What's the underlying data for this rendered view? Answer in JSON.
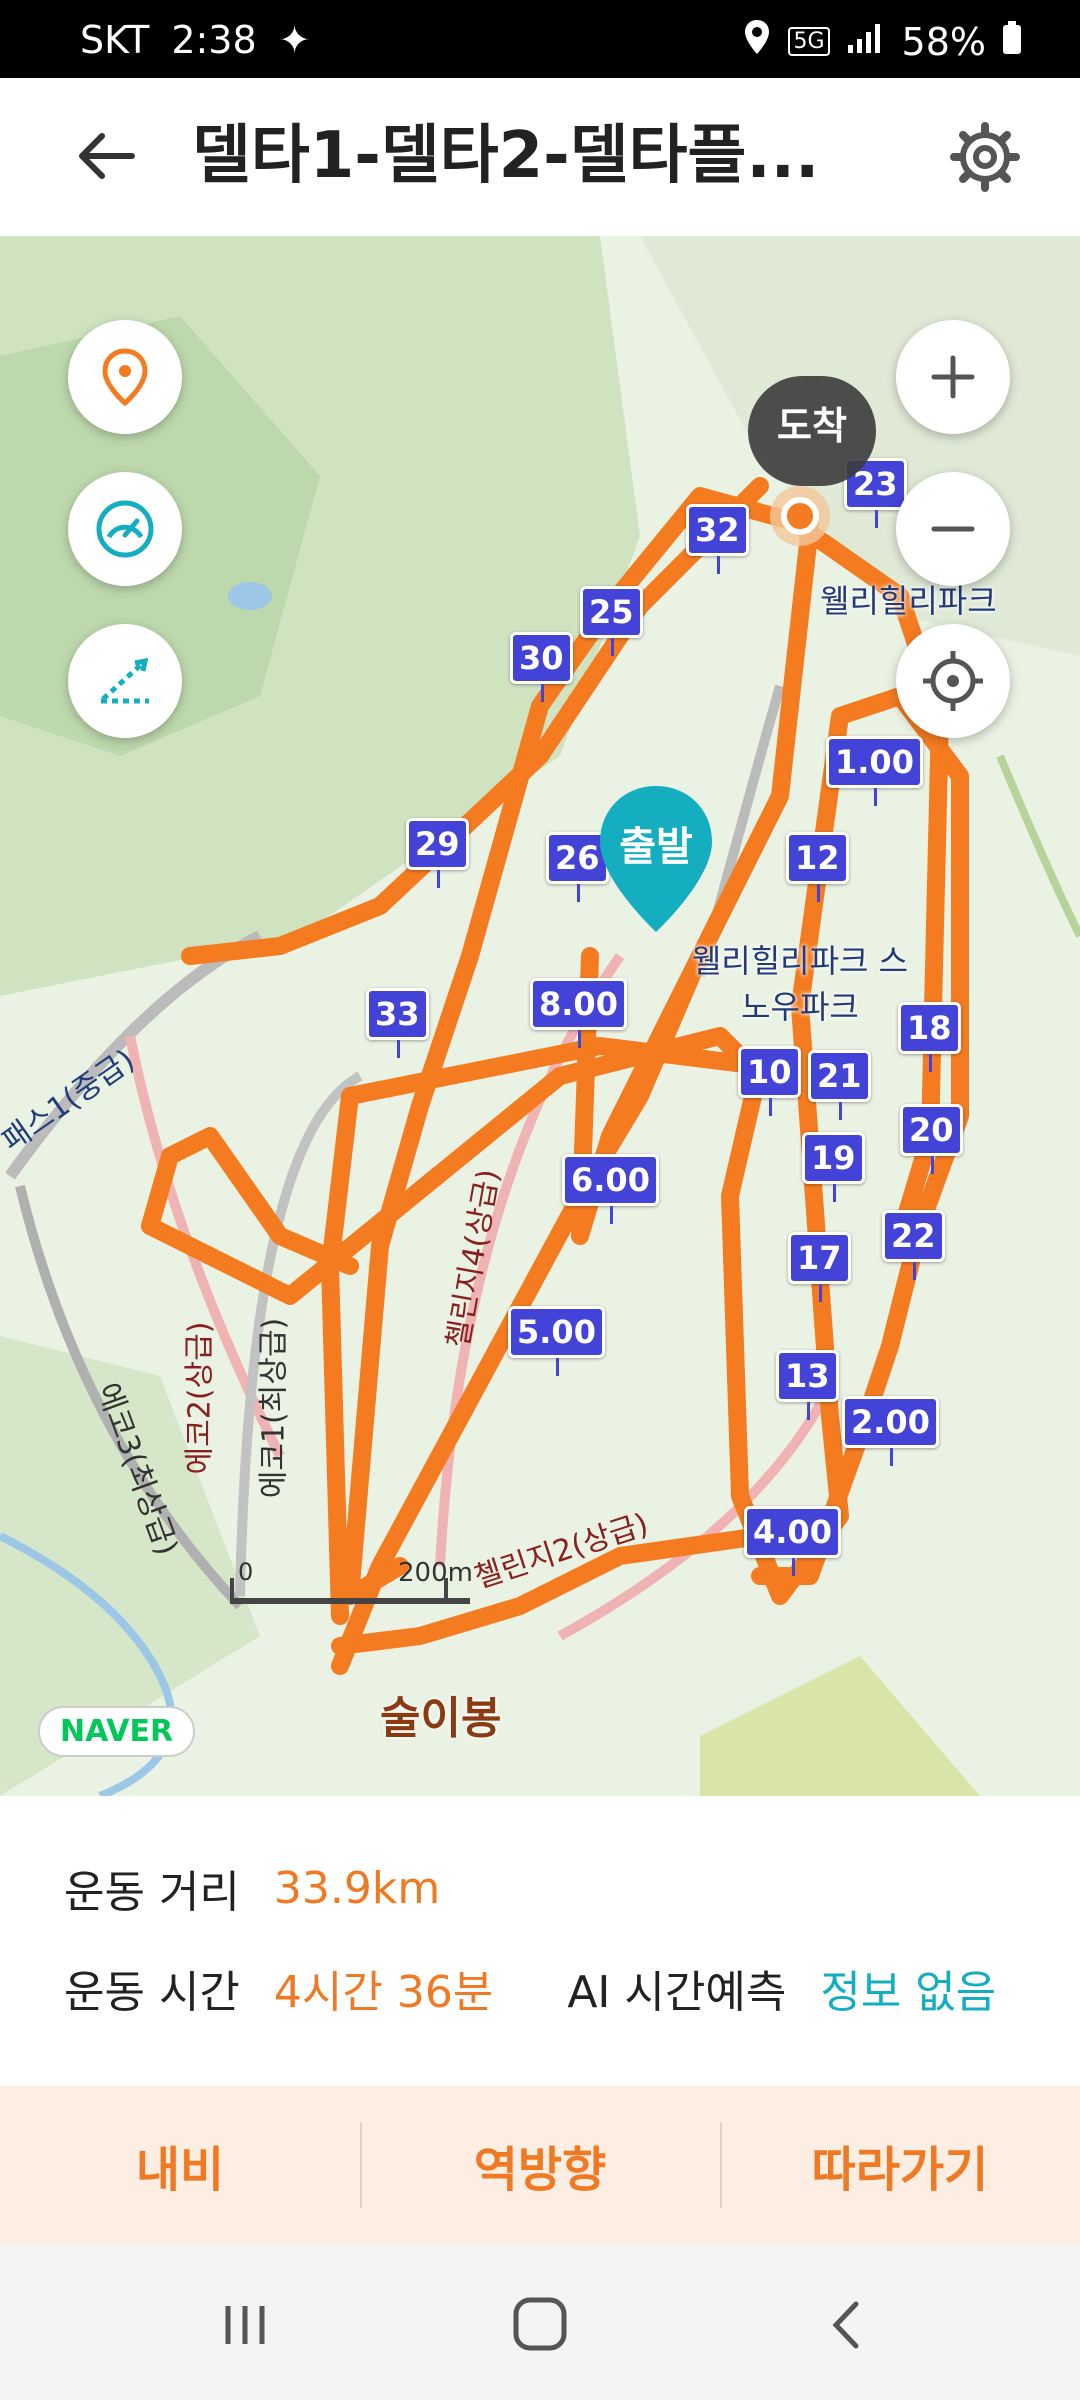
{
  "status_bar": {
    "carrier": "SKT",
    "time": "2:38",
    "network": "5G",
    "battery": "58%"
  },
  "header": {
    "title": "델타1-델타2-델타플..."
  },
  "map": {
    "start_label": "출발",
    "arrival_label": "도착",
    "naver_logo": "NAVER",
    "scale_zero": "0",
    "scale_label": "200m",
    "poi_labels": [
      "웰리힐리파크",
      "웰리힐리파크 스노우파크",
      "술이봉"
    ],
    "trail_labels": [
      "에코2(상급)",
      "에코3(최상급)",
      "에코1(최상급)",
      "첼린지4(상급)",
      "첼린지2(상급)",
      "패스1(중급)"
    ],
    "distance_markers": [
      "1.00",
      "2.00",
      "4.00",
      "5.00",
      "6.00",
      "8.00"
    ],
    "point_markers": [
      "10",
      "12",
      "13",
      "17",
      "18",
      "19",
      "20",
      "21",
      "22",
      "23",
      "25",
      "26",
      "29",
      "30",
      "32",
      "33"
    ]
  },
  "stats": {
    "distance_label": "운동 거리",
    "distance_value": "33.9km",
    "time_label": "운동 시간",
    "time_value": "4시간 36분",
    "ai_label": "AI 시간예측",
    "ai_value": "정보 없음"
  },
  "actions": {
    "navi": "내비",
    "reverse": "역방향",
    "follow": "따라가기"
  },
  "colors": {
    "route": "#f47b20",
    "marker": "#4343d8",
    "accent_teal": "#14aec0",
    "action_bg": "#fdeee3"
  }
}
